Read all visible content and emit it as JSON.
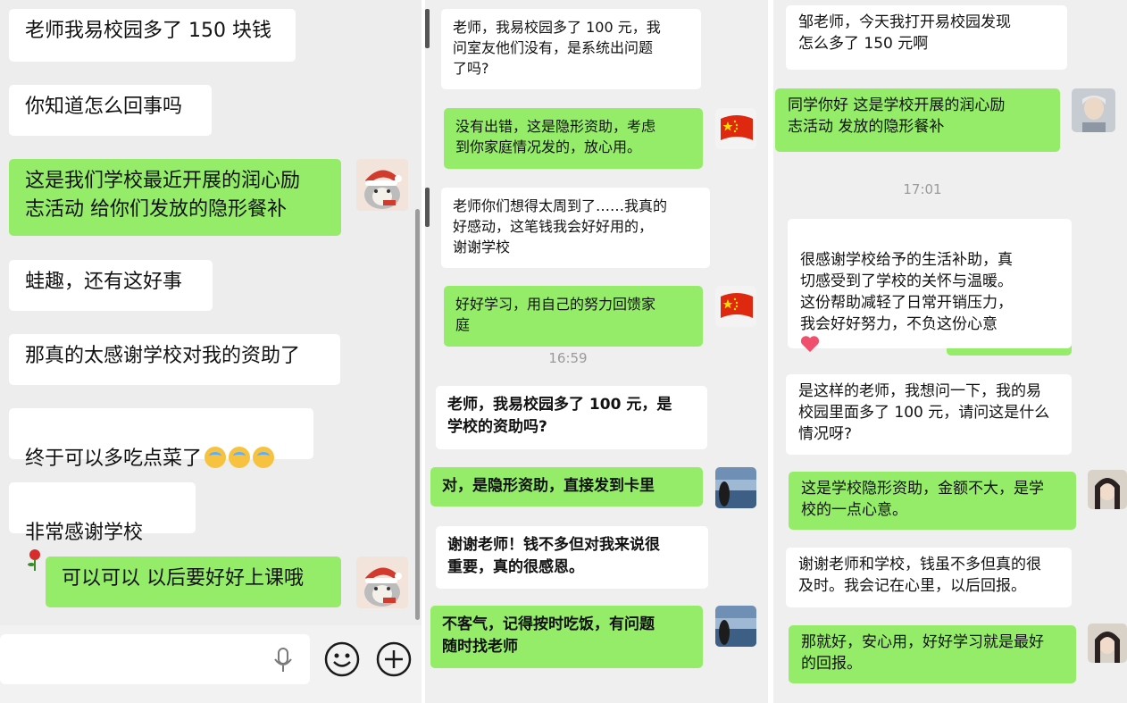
{
  "panel1": {
    "messages": [
      {
        "dir": "in",
        "text": "老师我易校园多了 150 块钱"
      },
      {
        "dir": "in",
        "text": "你知道怎么回事吗"
      },
      {
        "dir": "out",
        "text": "这是我们学校最近开展的润心励\n志活动 给你们发放的隐形餐补"
      },
      {
        "dir": "in",
        "text": "蛙趣，还有这好事"
      },
      {
        "dir": "in",
        "text": "那真的太感谢学校对我的资助了"
      },
      {
        "dir": "in",
        "text": "终于可以多吃点菜了"
      },
      {
        "dir": "in",
        "text": "非常感谢学校"
      },
      {
        "dir": "out",
        "text": "可以可以 以后要好好上课哦"
      }
    ],
    "emoji": {
      "crying": "crying-face",
      "rose": "rose"
    }
  },
  "panel2": {
    "messages": [
      {
        "dir": "in",
        "text": "老师，我易校园多了 100 元，我\n问室友他们没有，是系统出问题\n了吗?"
      },
      {
        "dir": "out",
        "text": "没有出错，这是隐形资助，考虑\n到你家庭情况发的，放心用。"
      },
      {
        "dir": "in",
        "text": "老师你们想得太周到了……我真的\n好感动，这笔钱我会好好用的，\n谢谢学校"
      },
      {
        "dir": "out",
        "text": "好好学习，用自己的努力回馈家\n庭"
      },
      {
        "dir": "in",
        "text": "老师，我易校园多了 100 元，是\n学校的资助吗?"
      },
      {
        "dir": "out",
        "text": "对，是隐形资助，直接发到卡里"
      },
      {
        "dir": "in",
        "text": "谢谢老师！钱不多但对我来说很\n重要，真的很感恩。"
      },
      {
        "dir": "out",
        "text": "不客气，记得按时吃饭，有问题\n随时找老师"
      }
    ],
    "time": "16:59"
  },
  "panel3": {
    "messages": [
      {
        "dir": "in",
        "text": "邹老师，今天我打开易校园发现\n怎么多了 150 元啊"
      },
      {
        "dir": "out",
        "text": "同学你好 这是学校开展的润心励\n志活动 发放的隐形餐补"
      },
      {
        "dir": "in",
        "text": "很感谢学校给予的生活补助，真\n切感受到了学校的关怀与温暖。\n这份帮助减轻了日常开销压力，\n我会好好努力，不负这份心意"
      },
      {
        "dir": "in",
        "text": "是这样的老师，我想问一下，我的易\n校园里面多了 100 元，请问这是什么\n情况呀?"
      },
      {
        "dir": "out",
        "text": "这是学校隐形资助，金额不大，是学\n校的一点心意。"
      },
      {
        "dir": "in",
        "text": "谢谢老师和学校，钱虽不多但真的很\n及时。我会记在心里，以后回报。"
      },
      {
        "dir": "out",
        "text": "那就好，安心用，好好学习就是最好\n的回报。"
      }
    ],
    "time": "17:01"
  },
  "input_bar": {
    "icons": [
      "microphone-icon",
      "emoji-icon",
      "plus-icon"
    ]
  }
}
